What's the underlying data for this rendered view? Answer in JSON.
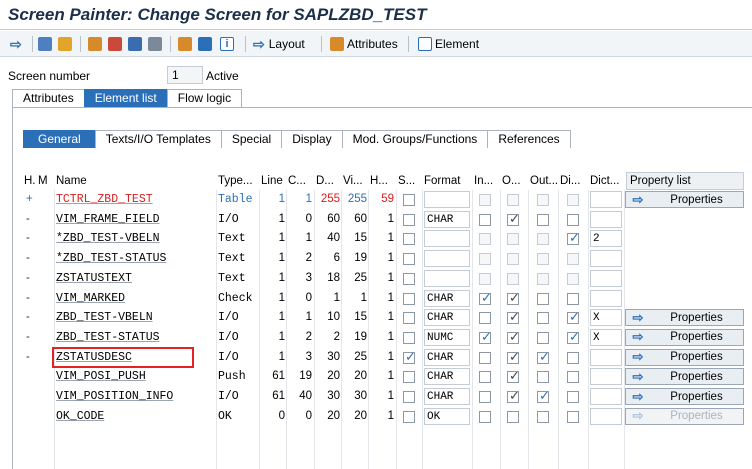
{
  "window": {
    "title": "Screen Painter: Change Screen for SAPLZBD_TEST"
  },
  "toolbar": {
    "layout_label": "Layout",
    "attributes_label": "Attributes",
    "element_label": "Element"
  },
  "screen": {
    "number_label": "Screen number",
    "number_value": "1",
    "status": "Active"
  },
  "main_tabs": [
    "Attributes",
    "Element list",
    "Flow logic"
  ],
  "sub_tabs": [
    "General",
    "Texts/I/O Templates",
    "Special",
    "Display",
    "Mod. Groups/Functions",
    "References"
  ],
  "columns": [
    "H..",
    "M",
    "Name",
    "Type...",
    "Line",
    "C...",
    "D...",
    "Vi...",
    "H...",
    "S...",
    "Format",
    "In...",
    "O...",
    "Out...",
    "Di...",
    "Dict...",
    "Property list"
  ],
  "rows": [
    {
      "h": "+",
      "name": "TCTRL_ZBD_TEST",
      "type": "Table",
      "line": "1",
      "col": "1",
      "d": "255",
      "vi": "255",
      "hh": "59",
      "format": "",
      "inp": "",
      "out": "",
      "outonly": "",
      "di": "",
      "dict": "",
      "prop": "Properties"
    },
    {
      "h": "-",
      "name": "VIM_FRAME_FIELD",
      "type": "I/O",
      "line": "1",
      "col": "0",
      "d": "60",
      "vi": "60",
      "hh": "1",
      "format": "CHAR",
      "inp": "",
      "out": "x",
      "outonly": "",
      "di": "",
      "dict": "",
      "prop": ""
    },
    {
      "h": "-",
      "name": "*ZBD_TEST-VBELN",
      "type": "Text",
      "line": "1",
      "col": "1",
      "d": "40",
      "vi": "15",
      "hh": "1",
      "format": "",
      "inp": "",
      "out": "",
      "outonly": "",
      "di": "x",
      "dict": "2",
      "prop": ""
    },
    {
      "h": "-",
      "name": "*ZBD_TEST-STATUS",
      "type": "Text",
      "line": "1",
      "col": "2",
      "d": "6",
      "vi": "19",
      "hh": "1",
      "format": "",
      "inp": "",
      "out": "",
      "outonly": "",
      "di": "",
      "dict": "",
      "prop": ""
    },
    {
      "h": "-",
      "name": "ZSTATUSTEXT",
      "type": "Text",
      "line": "1",
      "col": "3",
      "d": "18",
      "vi": "25",
      "hh": "1",
      "format": "",
      "inp": "",
      "out": "",
      "outonly": "",
      "di": "",
      "dict": "",
      "prop": ""
    },
    {
      "h": "-",
      "name": "VIM_MARKED",
      "type": "Check",
      "line": "1",
      "col": "0",
      "d": "1",
      "vi": "1",
      "hh": "1",
      "format": "CHAR",
      "inp": "x",
      "out": "x",
      "outonly": "",
      "di": "",
      "dict": "",
      "prop": ""
    },
    {
      "h": "-",
      "name": "ZBD_TEST-VBELN",
      "type": "I/O",
      "line": "1",
      "col": "1",
      "d": "10",
      "vi": "15",
      "hh": "1",
      "format": "CHAR",
      "inp": "",
      "out": "x",
      "outonly": "",
      "di": "x",
      "dict": "X",
      "prop": "Properties"
    },
    {
      "h": "-",
      "name": "ZBD_TEST-STATUS",
      "type": "I/O",
      "line": "1",
      "col": "2",
      "d": "2",
      "vi": "19",
      "hh": "1",
      "format": "NUMC",
      "inp": "x",
      "out": "x",
      "outonly": "",
      "di": "x",
      "dict": "X",
      "prop": "Properties"
    },
    {
      "h": "-",
      "name": "ZSTATUSDESC",
      "type": "I/O",
      "line": "1",
      "col": "3",
      "d": "30",
      "vi": "25",
      "hh": "1",
      "format": "CHAR",
      "inp": "",
      "out": "x",
      "outonly": "x",
      "di": "",
      "dict": "",
      "prop": "Properties",
      "s": "x",
      "highlight": true
    },
    {
      "h": "",
      "name": "VIM_POSI_PUSH",
      "type": "Push",
      "line": "61",
      "col": "19",
      "d": "20",
      "vi": "20",
      "hh": "1",
      "format": "CHAR",
      "inp": "",
      "out": "x",
      "outonly": "",
      "di": "",
      "dict": "",
      "prop": "Properties"
    },
    {
      "h": "",
      "name": "VIM_POSITION_INFO",
      "type": "I/O",
      "line": "61",
      "col": "40",
      "d": "30",
      "vi": "30",
      "hh": "1",
      "format": "CHAR",
      "inp": "",
      "out": "x",
      "outonly": "x",
      "di": "",
      "dict": "",
      "prop": "Properties"
    },
    {
      "h": "",
      "name": "OK_CODE",
      "type": "OK",
      "line": "0",
      "col": "0",
      "d": "20",
      "vi": "20",
      "hh": "1",
      "format": "OK",
      "inp": "",
      "out": "",
      "outonly": "",
      "di": "",
      "dict": "",
      "prop": "Properties",
      "propDisabled": true
    }
  ]
}
